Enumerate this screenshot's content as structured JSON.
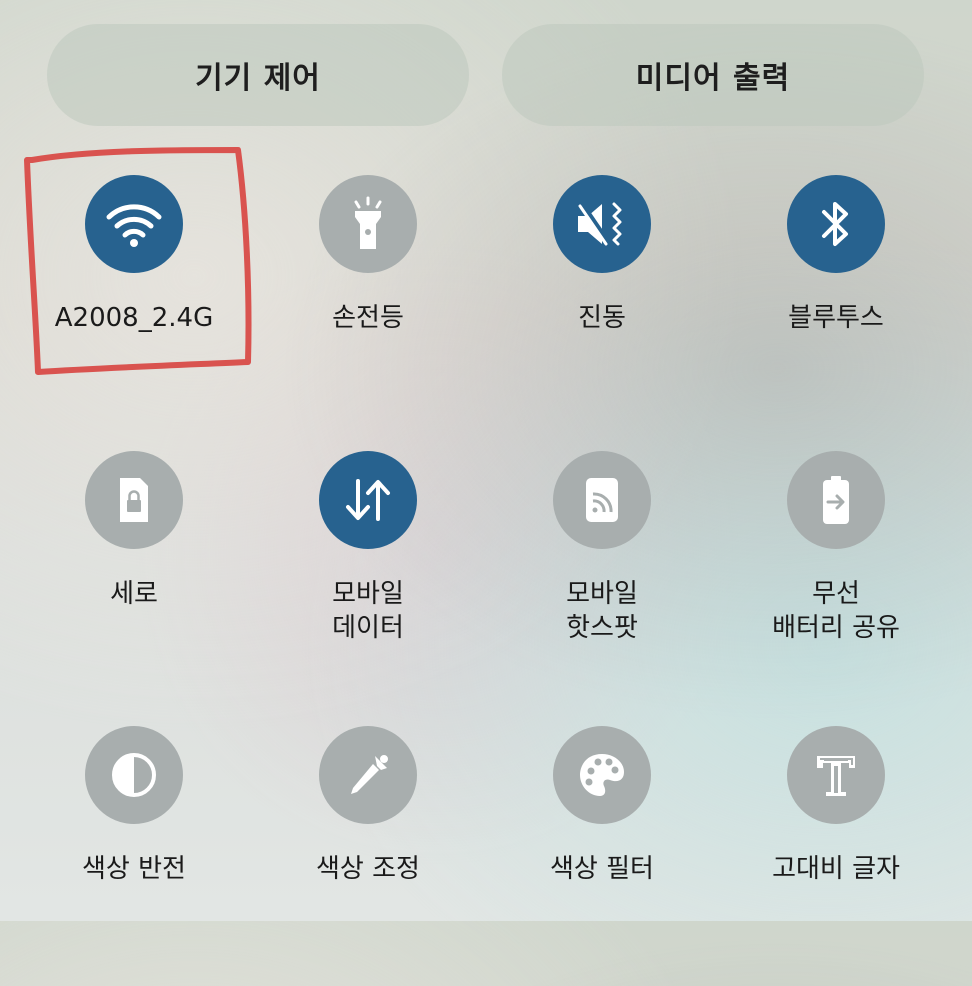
{
  "top_buttons": {
    "device_control": "기기 제어",
    "media_output": "미디어 출력"
  },
  "tiles": [
    {
      "label": "A2008_2.4G",
      "icon": "wifi-icon",
      "state": "on",
      "highlighted": true
    },
    {
      "label": "손전등",
      "icon": "flashlight-icon",
      "state": "off"
    },
    {
      "label": "진동",
      "icon": "vibrate-icon",
      "state": "on"
    },
    {
      "label": "블루투스",
      "icon": "bluetooth-icon",
      "state": "on"
    },
    {
      "label": "세로",
      "icon": "portrait-lock-icon",
      "state": "off"
    },
    {
      "label_line1": "모바일",
      "label_line2": "데이터",
      "icon": "mobile-data-icon",
      "state": "on"
    },
    {
      "label_line1": "모바일",
      "label_line2": "핫스팟",
      "icon": "hotspot-icon",
      "state": "off"
    },
    {
      "label_line1": "무선",
      "label_line2": "배터리 공유",
      "icon": "battery-share-icon",
      "state": "off"
    },
    {
      "label": "색상 반전",
      "icon": "color-inversion-icon",
      "state": "off"
    },
    {
      "label": "색상 조정",
      "icon": "color-adjust-icon",
      "state": "off"
    },
    {
      "label": "색상 필터",
      "icon": "color-filter-icon",
      "state": "off"
    },
    {
      "label": "고대비 글자",
      "icon": "high-contrast-text-icon",
      "state": "off"
    }
  ],
  "colors": {
    "active": "#27628f",
    "inactive": "#a8aeae",
    "highlight": "#d9534f"
  }
}
